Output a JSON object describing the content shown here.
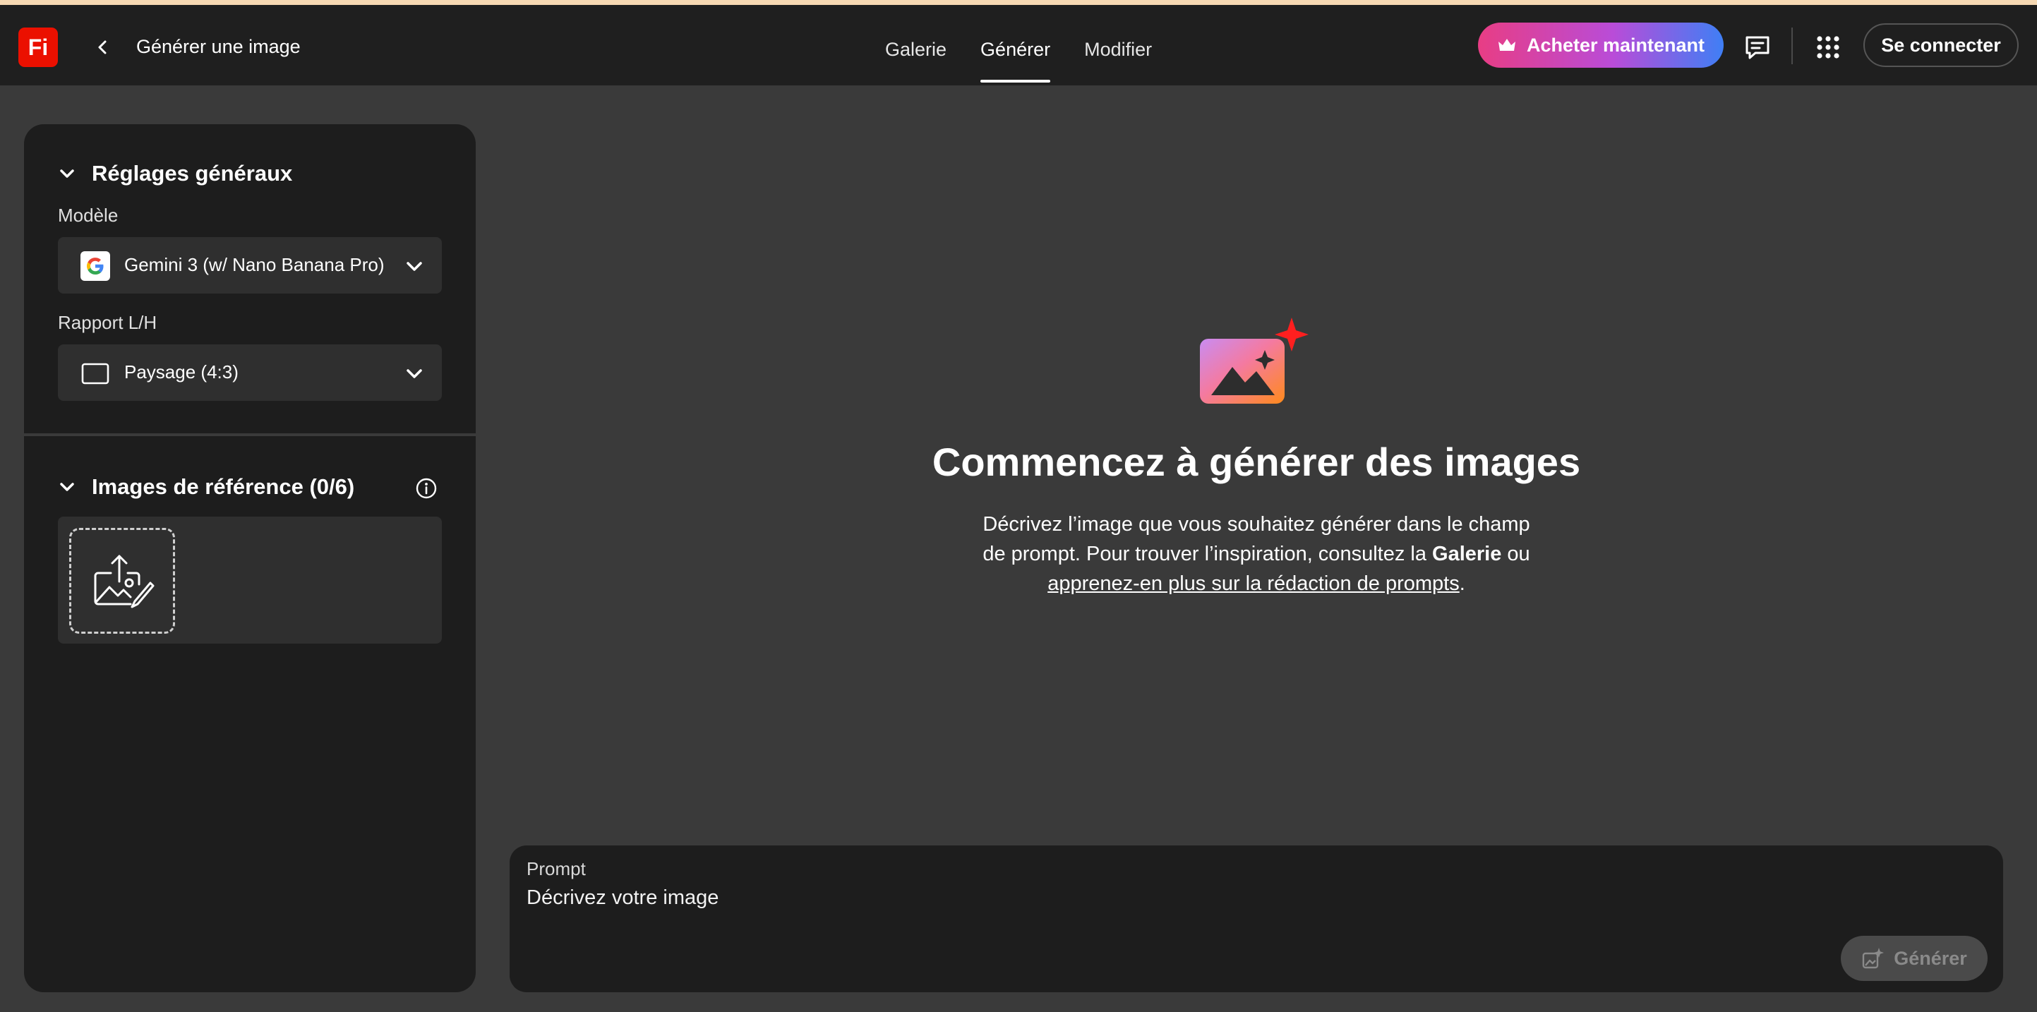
{
  "header": {
    "logo_text": "Fi",
    "title": "Générer une image",
    "tabs": [
      {
        "label": "Galerie",
        "active": false
      },
      {
        "label": "Générer",
        "active": true
      },
      {
        "label": "Modifier",
        "active": false
      }
    ],
    "buy_label": "Acheter maintenant",
    "signin_label": "Se connecter",
    "icons": [
      "crown-icon",
      "feedback-icon",
      "apps-grid-icon"
    ]
  },
  "sidebar": {
    "general": {
      "title": "Réglages généraux",
      "model_label": "Modèle",
      "model_value": "Gemini 3 (w/ Nano Banana Pro)",
      "ratio_label": "Rapport L/H",
      "ratio_value": "Paysage (4:3)"
    },
    "reference": {
      "title": "Images de référence (0/6)"
    }
  },
  "main": {
    "title": "Commencez à générer des images",
    "desc_line1": "Décrivez l’image que vous souhaitez générer dans le champ",
    "desc_line2a": "de prompt. Pour trouver l’inspiration, consultez la ",
    "desc_bold": "Galerie",
    "desc_line2b": " ou",
    "desc_link": "apprenez-en plus sur la rédaction de prompts",
    "desc_end": "."
  },
  "prompt": {
    "label": "Prompt",
    "placeholder": "Décrivez votre image",
    "value": "",
    "generate_label": "Générer"
  },
  "colors": {
    "brand": "#eb1000",
    "header_bg": "#1f1f1f",
    "canvas_bg": "#3a3a3a",
    "panel_bg": "#1d1d1d",
    "buy_gradient_start": "#e83d84",
    "buy_gradient_end": "#3f7ff5"
  }
}
